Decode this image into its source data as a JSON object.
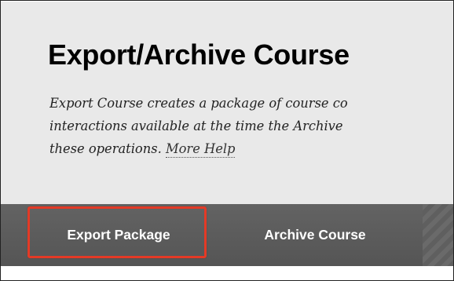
{
  "page": {
    "title": "Export/Archive Course",
    "description_lines": [
      "Export Course creates a package of course co",
      "interactions available at the time the Archive",
      "these operations."
    ],
    "help_link": "More Help"
  },
  "tabs": [
    {
      "label": "Export Package",
      "highlighted": true
    },
    {
      "label": "Archive Course",
      "highlighted": false
    }
  ],
  "colors": {
    "panel_bg": "#e9e9e9",
    "tab_bar_bg": "#5c5c5c",
    "highlight": "#e43a26"
  }
}
